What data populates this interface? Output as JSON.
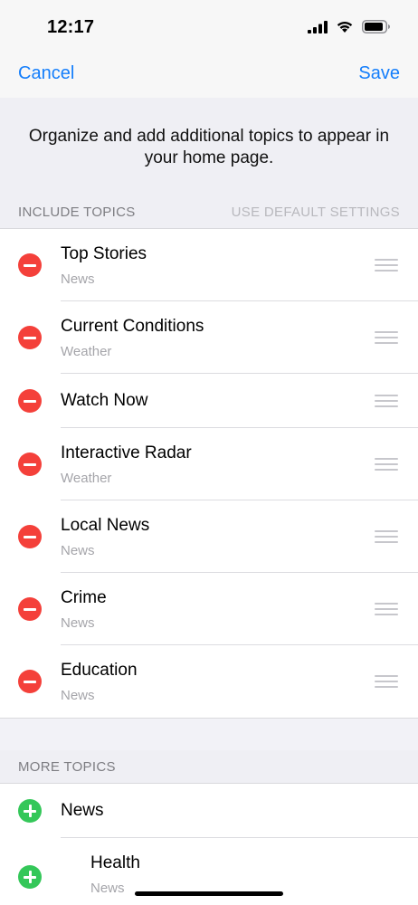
{
  "status_bar": {
    "time": "12:17"
  },
  "nav": {
    "cancel_label": "Cancel",
    "save_label": "Save"
  },
  "intro": {
    "text": "Organize and add additional topics to appear in your home page."
  },
  "include_section": {
    "title": "INCLUDE TOPICS",
    "action_label": "USE DEFAULT SETTINGS",
    "items": [
      {
        "title": "Top Stories",
        "subtitle": "News"
      },
      {
        "title": "Current Conditions",
        "subtitle": "Weather"
      },
      {
        "title": "Watch Now",
        "subtitle": ""
      },
      {
        "title": "Interactive Radar",
        "subtitle": "Weather"
      },
      {
        "title": "Local News",
        "subtitle": "News"
      },
      {
        "title": "Crime",
        "subtitle": "News"
      },
      {
        "title": "Education",
        "subtitle": "News"
      }
    ]
  },
  "more_section": {
    "title": "MORE TOPICS",
    "items": [
      {
        "title": "News",
        "subtitle": ""
      },
      {
        "title": "Health",
        "subtitle": "News"
      }
    ]
  },
  "colors": {
    "accent": "#147efb",
    "remove": "#f4403a",
    "add": "#34c759"
  }
}
